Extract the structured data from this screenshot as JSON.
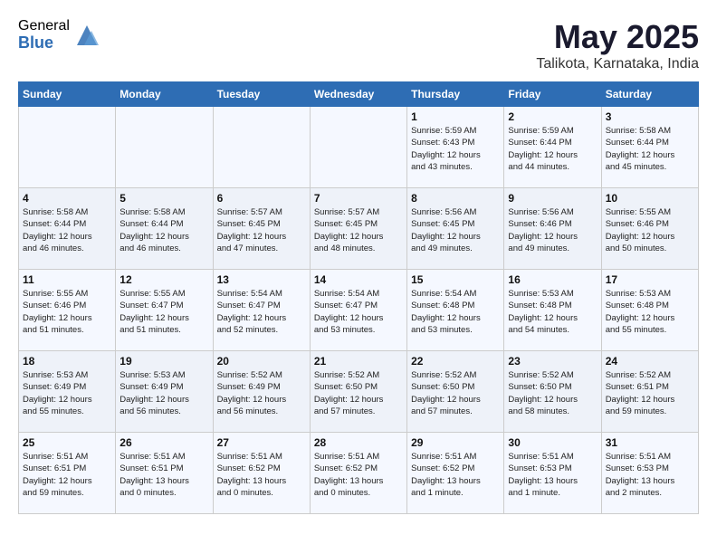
{
  "logo": {
    "general": "General",
    "blue": "Blue"
  },
  "title": "May 2025",
  "subtitle": "Talikota, Karnataka, India",
  "days_of_week": [
    "Sunday",
    "Monday",
    "Tuesday",
    "Wednesday",
    "Thursday",
    "Friday",
    "Saturday"
  ],
  "weeks": [
    [
      {
        "num": "",
        "info": ""
      },
      {
        "num": "",
        "info": ""
      },
      {
        "num": "",
        "info": ""
      },
      {
        "num": "",
        "info": ""
      },
      {
        "num": "1",
        "info": "Sunrise: 5:59 AM\nSunset: 6:43 PM\nDaylight: 12 hours\nand 43 minutes."
      },
      {
        "num": "2",
        "info": "Sunrise: 5:59 AM\nSunset: 6:44 PM\nDaylight: 12 hours\nand 44 minutes."
      },
      {
        "num": "3",
        "info": "Sunrise: 5:58 AM\nSunset: 6:44 PM\nDaylight: 12 hours\nand 45 minutes."
      }
    ],
    [
      {
        "num": "4",
        "info": "Sunrise: 5:58 AM\nSunset: 6:44 PM\nDaylight: 12 hours\nand 46 minutes."
      },
      {
        "num": "5",
        "info": "Sunrise: 5:58 AM\nSunset: 6:44 PM\nDaylight: 12 hours\nand 46 minutes."
      },
      {
        "num": "6",
        "info": "Sunrise: 5:57 AM\nSunset: 6:45 PM\nDaylight: 12 hours\nand 47 minutes."
      },
      {
        "num": "7",
        "info": "Sunrise: 5:57 AM\nSunset: 6:45 PM\nDaylight: 12 hours\nand 48 minutes."
      },
      {
        "num": "8",
        "info": "Sunrise: 5:56 AM\nSunset: 6:45 PM\nDaylight: 12 hours\nand 49 minutes."
      },
      {
        "num": "9",
        "info": "Sunrise: 5:56 AM\nSunset: 6:46 PM\nDaylight: 12 hours\nand 49 minutes."
      },
      {
        "num": "10",
        "info": "Sunrise: 5:55 AM\nSunset: 6:46 PM\nDaylight: 12 hours\nand 50 minutes."
      }
    ],
    [
      {
        "num": "11",
        "info": "Sunrise: 5:55 AM\nSunset: 6:46 PM\nDaylight: 12 hours\nand 51 minutes."
      },
      {
        "num": "12",
        "info": "Sunrise: 5:55 AM\nSunset: 6:47 PM\nDaylight: 12 hours\nand 51 minutes."
      },
      {
        "num": "13",
        "info": "Sunrise: 5:54 AM\nSunset: 6:47 PM\nDaylight: 12 hours\nand 52 minutes."
      },
      {
        "num": "14",
        "info": "Sunrise: 5:54 AM\nSunset: 6:47 PM\nDaylight: 12 hours\nand 53 minutes."
      },
      {
        "num": "15",
        "info": "Sunrise: 5:54 AM\nSunset: 6:48 PM\nDaylight: 12 hours\nand 53 minutes."
      },
      {
        "num": "16",
        "info": "Sunrise: 5:53 AM\nSunset: 6:48 PM\nDaylight: 12 hours\nand 54 minutes."
      },
      {
        "num": "17",
        "info": "Sunrise: 5:53 AM\nSunset: 6:48 PM\nDaylight: 12 hours\nand 55 minutes."
      }
    ],
    [
      {
        "num": "18",
        "info": "Sunrise: 5:53 AM\nSunset: 6:49 PM\nDaylight: 12 hours\nand 55 minutes."
      },
      {
        "num": "19",
        "info": "Sunrise: 5:53 AM\nSunset: 6:49 PM\nDaylight: 12 hours\nand 56 minutes."
      },
      {
        "num": "20",
        "info": "Sunrise: 5:52 AM\nSunset: 6:49 PM\nDaylight: 12 hours\nand 56 minutes."
      },
      {
        "num": "21",
        "info": "Sunrise: 5:52 AM\nSunset: 6:50 PM\nDaylight: 12 hours\nand 57 minutes."
      },
      {
        "num": "22",
        "info": "Sunrise: 5:52 AM\nSunset: 6:50 PM\nDaylight: 12 hours\nand 57 minutes."
      },
      {
        "num": "23",
        "info": "Sunrise: 5:52 AM\nSunset: 6:50 PM\nDaylight: 12 hours\nand 58 minutes."
      },
      {
        "num": "24",
        "info": "Sunrise: 5:52 AM\nSunset: 6:51 PM\nDaylight: 12 hours\nand 59 minutes."
      }
    ],
    [
      {
        "num": "25",
        "info": "Sunrise: 5:51 AM\nSunset: 6:51 PM\nDaylight: 12 hours\nand 59 minutes."
      },
      {
        "num": "26",
        "info": "Sunrise: 5:51 AM\nSunset: 6:51 PM\nDaylight: 13 hours\nand 0 minutes."
      },
      {
        "num": "27",
        "info": "Sunrise: 5:51 AM\nSunset: 6:52 PM\nDaylight: 13 hours\nand 0 minutes."
      },
      {
        "num": "28",
        "info": "Sunrise: 5:51 AM\nSunset: 6:52 PM\nDaylight: 13 hours\nand 0 minutes."
      },
      {
        "num": "29",
        "info": "Sunrise: 5:51 AM\nSunset: 6:52 PM\nDaylight: 13 hours\nand 1 minute."
      },
      {
        "num": "30",
        "info": "Sunrise: 5:51 AM\nSunset: 6:53 PM\nDaylight: 13 hours\nand 1 minute."
      },
      {
        "num": "31",
        "info": "Sunrise: 5:51 AM\nSunset: 6:53 PM\nDaylight: 13 hours\nand 2 minutes."
      }
    ]
  ]
}
